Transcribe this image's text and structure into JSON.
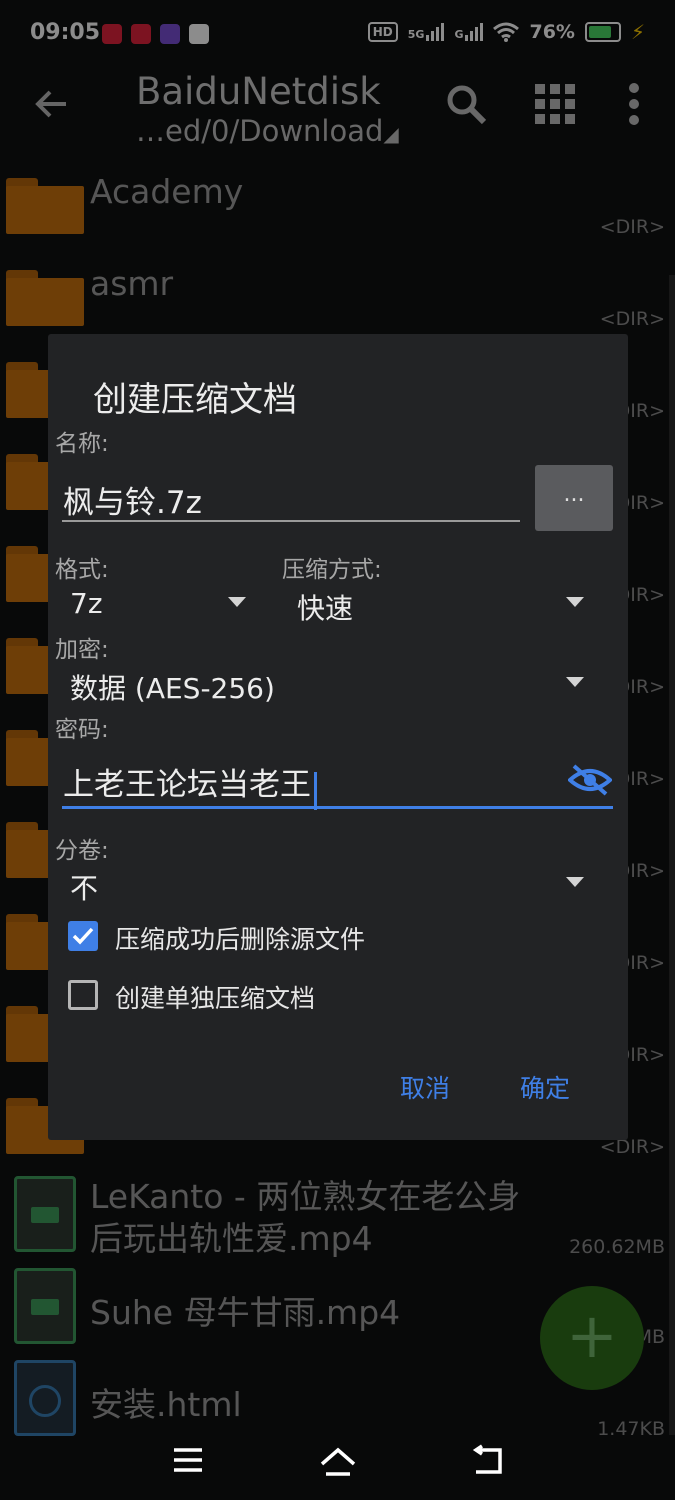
{
  "status_bar": {
    "time": "09:05",
    "hd": "HD",
    "net1": "5G",
    "net2": "G",
    "battery_percent": "76%",
    "app_icon_colors": [
      "#e2233c",
      "#e2233c",
      "#7a4fd6",
      "#3a3a3a"
    ]
  },
  "app_bar": {
    "title": "BaiduNetdisk",
    "path": "…ed/0/Download",
    "icons": [
      "back-arrow-icon",
      "search-icon",
      "grid-view-icon",
      "more-vert-icon"
    ]
  },
  "file_list": [
    {
      "name": "Academy",
      "meta": "<DIR>",
      "type": "folder"
    },
    {
      "name": "asmr",
      "meta": "<DIR>",
      "type": "folder"
    },
    {
      "name": "",
      "meta": "DIR>",
      "type": "folder"
    },
    {
      "name": "",
      "meta": "DIR>",
      "type": "folder"
    },
    {
      "name": "",
      "meta": "DIR>",
      "type": "folder"
    },
    {
      "name": "",
      "meta": "DIR>",
      "type": "folder"
    },
    {
      "name": "",
      "meta": "DIR>",
      "type": "folder"
    },
    {
      "name": "",
      "meta": "DIR>",
      "type": "folder"
    },
    {
      "name": "",
      "meta": "DIR>",
      "type": "folder"
    },
    {
      "name": "",
      "meta": "DIR>",
      "type": "folder"
    },
    {
      "name": "",
      "meta": "<DIR>",
      "type": "folder"
    },
    {
      "name": "LeKanto - 两位熟女在老公身\n后玩出轨性爱.mp4",
      "meta": "260.62MB",
      "type": "video"
    },
    {
      "name": "Suhe 母牛甘雨.mp4",
      "meta": "MB",
      "type": "video"
    },
    {
      "name": "安装.html",
      "meta": "1.47KB",
      "type": "html"
    }
  ],
  "dialog": {
    "title": "创建压缩文档",
    "name_label": "名称:",
    "name_value": "枫与铃.7z",
    "more_button": "...",
    "format_label": "格式:",
    "format_value": "7z",
    "method_label": "压缩方式:",
    "method_value": "快速",
    "encrypt_label": "加密:",
    "encrypt_value": "数据 (AES-256)",
    "password_label": "密码:",
    "password_value": "上老王论坛当老王",
    "split_label": "分卷:",
    "split_value": "不",
    "delete_source": {
      "label": "压缩成功后删除源文件",
      "checked": true
    },
    "separate_archive": {
      "label": "创建单独压缩文档",
      "checked": false
    },
    "cancel": "取消",
    "ok": "确定",
    "accent_color": "#3f7fe6"
  },
  "fab": {
    "symbol": "+"
  },
  "nav_bar": {
    "icons": [
      "menu-icon",
      "home-icon",
      "back-icon"
    ]
  }
}
